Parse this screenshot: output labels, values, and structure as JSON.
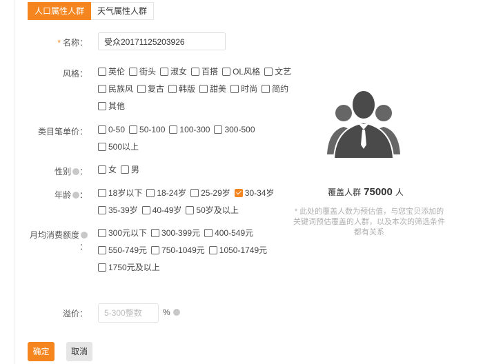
{
  "tabs": [
    {
      "label": "人口属性人群",
      "active": true
    },
    {
      "label": "天气属性人群",
      "active": false
    }
  ],
  "name": {
    "label": "名称：",
    "required_mark": "*",
    "value": "受众20171125203926"
  },
  "style": {
    "label": "风格：",
    "rows": [
      [
        {
          "label": "英伦",
          "checked": false
        },
        {
          "label": "街头",
          "checked": false
        },
        {
          "label": "淑女",
          "checked": false
        },
        {
          "label": "百搭",
          "checked": false
        },
        {
          "label": "OL风格",
          "checked": false
        },
        {
          "label": "文艺",
          "checked": false
        }
      ],
      [
        {
          "label": "民族风",
          "checked": false
        },
        {
          "label": "复古",
          "checked": false
        },
        {
          "label": "韩版",
          "checked": false
        },
        {
          "label": "甜美",
          "checked": false
        },
        {
          "label": "时尚",
          "checked": false
        },
        {
          "label": "简约",
          "checked": false
        }
      ],
      [
        {
          "label": "其他",
          "checked": false
        }
      ]
    ]
  },
  "price": {
    "label": "类目笔单价：",
    "rows": [
      [
        {
          "label": "0-50",
          "checked": false
        },
        {
          "label": "50-100",
          "checked": false
        },
        {
          "label": "100-300",
          "checked": false
        },
        {
          "label": "300-500",
          "checked": false
        }
      ],
      [
        {
          "label": "500以上",
          "checked": false
        }
      ]
    ]
  },
  "gender": {
    "label": "性别",
    "rows": [
      [
        {
          "label": "女",
          "checked": false
        },
        {
          "label": "男",
          "checked": false
        }
      ]
    ]
  },
  "age": {
    "label": "年龄",
    "rows": [
      [
        {
          "label": "18岁以下",
          "checked": false
        },
        {
          "label": "18-24岁",
          "checked": false
        },
        {
          "label": "25-29岁",
          "checked": false
        },
        {
          "label": "30-34岁",
          "checked": true
        }
      ],
      [
        {
          "label": "35-39岁",
          "checked": false
        },
        {
          "label": "40-49岁",
          "checked": false
        },
        {
          "label": "50岁及以上",
          "checked": false
        }
      ]
    ]
  },
  "spend": {
    "label": "月均消费额度",
    "rows": [
      [
        {
          "label": "300元以下",
          "checked": false
        },
        {
          "label": "300-399元",
          "checked": false
        },
        {
          "label": "400-549元",
          "checked": false
        }
      ],
      [
        {
          "label": "550-749元",
          "checked": false
        },
        {
          "label": "750-1049元",
          "checked": false
        },
        {
          "label": "1050-1749元",
          "checked": false
        }
      ],
      [
        {
          "label": "1750元及以上",
          "checked": false
        }
      ]
    ]
  },
  "premium": {
    "label": "溢价：",
    "placeholder": "5-300整数",
    "unit": "%"
  },
  "buttons": {
    "confirm": "确定",
    "cancel": "取消"
  },
  "coverage": {
    "prefix": "覆盖人群",
    "count": "75000",
    "suffix": "人",
    "note": "* 此处的覆盖人数为预估值，与您宝贝添加的关键词预估覆盖的人群，以及本次的筛选条件都有关系"
  },
  "colors": {
    "accent": "#f5861f",
    "icon_gray": "#555555"
  },
  "icons": {
    "people": "people-group-icon",
    "info": "info-circle-icon"
  }
}
